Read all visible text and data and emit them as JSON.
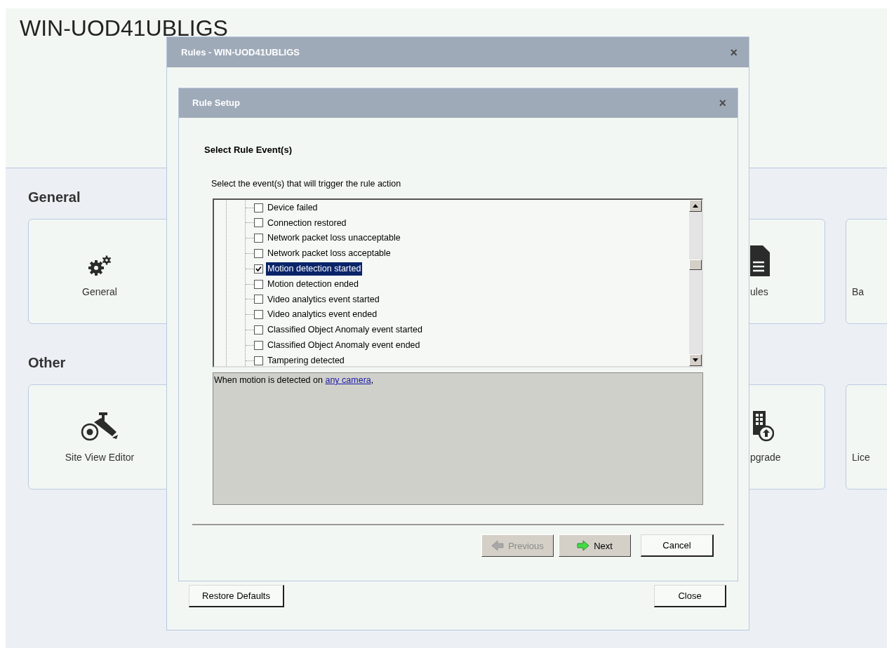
{
  "page": {
    "title": "WIN-UOD41UBLIGS",
    "sections": [
      {
        "heading": "General",
        "cards": [
          {
            "label": "General"
          },
          {
            "label": "ules"
          },
          {
            "label": "Ba"
          }
        ]
      },
      {
        "heading": "Other",
        "cards": [
          {
            "label": "Site View Editor"
          },
          {
            "label": "pgrade"
          },
          {
            "label": "Lice"
          }
        ]
      }
    ]
  },
  "rules_dialog": {
    "title": "Rules - WIN-UOD41UBLIGS",
    "close": "×",
    "buttons": [
      {
        "label": "Restore Defaults"
      },
      {
        "label": "Close"
      }
    ],
    "rule_setup": {
      "title": "Rule Setup",
      "close": "×",
      "heading": "Select Rule Event(s)",
      "instruction": "Select the event(s) that will trigger the rule action",
      "events": [
        {
          "label": "Device failed",
          "checked": false,
          "selected": false
        },
        {
          "label": "Connection restored",
          "checked": false,
          "selected": false
        },
        {
          "label": "Network packet loss unacceptable",
          "checked": false,
          "selected": false
        },
        {
          "label": "Network packet loss acceptable",
          "checked": false,
          "selected": false
        },
        {
          "label": "Motion detection started",
          "checked": true,
          "selected": true
        },
        {
          "label": "Motion detection ended",
          "checked": false,
          "selected": false
        },
        {
          "label": "Video analytics event started",
          "checked": false,
          "selected": false
        },
        {
          "label": "Video analytics event ended",
          "checked": false,
          "selected": false
        },
        {
          "label": "Classified Object Anomaly event started",
          "checked": false,
          "selected": false
        },
        {
          "label": "Classified Object Anomaly event ended",
          "checked": false,
          "selected": false
        },
        {
          "label": "Tampering detected",
          "checked": false,
          "selected": false
        }
      ],
      "description": {
        "before": "When motion is detected on ",
        "link": "any camera",
        "after": ","
      },
      "buttons": [
        {
          "label": "Previous",
          "kind": "back",
          "disabled": true
        },
        {
          "label": "Next",
          "kind": "forward",
          "disabled": false
        },
        {
          "label": "Cancel",
          "kind": "plain",
          "disabled": false
        }
      ]
    }
  }
}
